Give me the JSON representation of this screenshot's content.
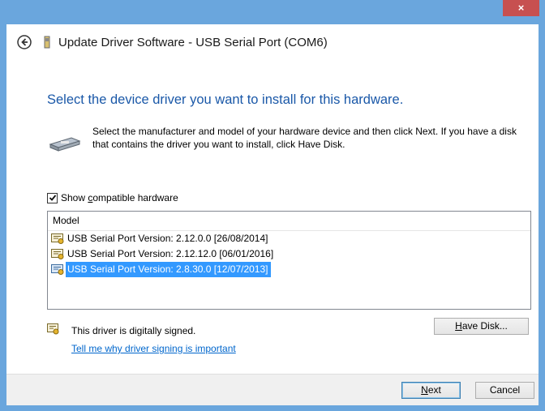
{
  "window": {
    "title": "Update Driver Software - USB Serial Port (COM6)",
    "close_label": "×"
  },
  "main": {
    "heading": "Select the device driver you want to install for this hardware.",
    "instructions": "Select the manufacturer and model of your hardware device and then click Next. If you have a disk that contains the driver you want to install, click Have Disk.",
    "show_compatible": {
      "prefix": "Show ",
      "accel": "c",
      "suffix": "ompatible hardware",
      "checked": true
    },
    "model_list": {
      "header": "Model",
      "items": [
        {
          "label": "USB Serial Port Version: 2.12.0.0 [26/08/2014]",
          "selected": false
        },
        {
          "label": "USB Serial Port Version: 2.12.12.0 [06/01/2016]",
          "selected": false
        },
        {
          "label": "USB Serial Port Version: 2.8.30.0 [12/07/2013]",
          "selected": true
        }
      ]
    },
    "signed_text": "This driver is digitally signed.",
    "signing_link": "Tell me why driver signing is important",
    "have_disk": {
      "accel": "H",
      "rest": "ave Disk..."
    }
  },
  "footer": {
    "next": {
      "accel": "N",
      "rest": "ext"
    },
    "cancel": "Cancel"
  },
  "colors": {
    "frame": "#6aa6dd",
    "heading": "#1a58a8",
    "selection": "#3399ff",
    "link": "#0066cc",
    "close": "#c75050"
  }
}
